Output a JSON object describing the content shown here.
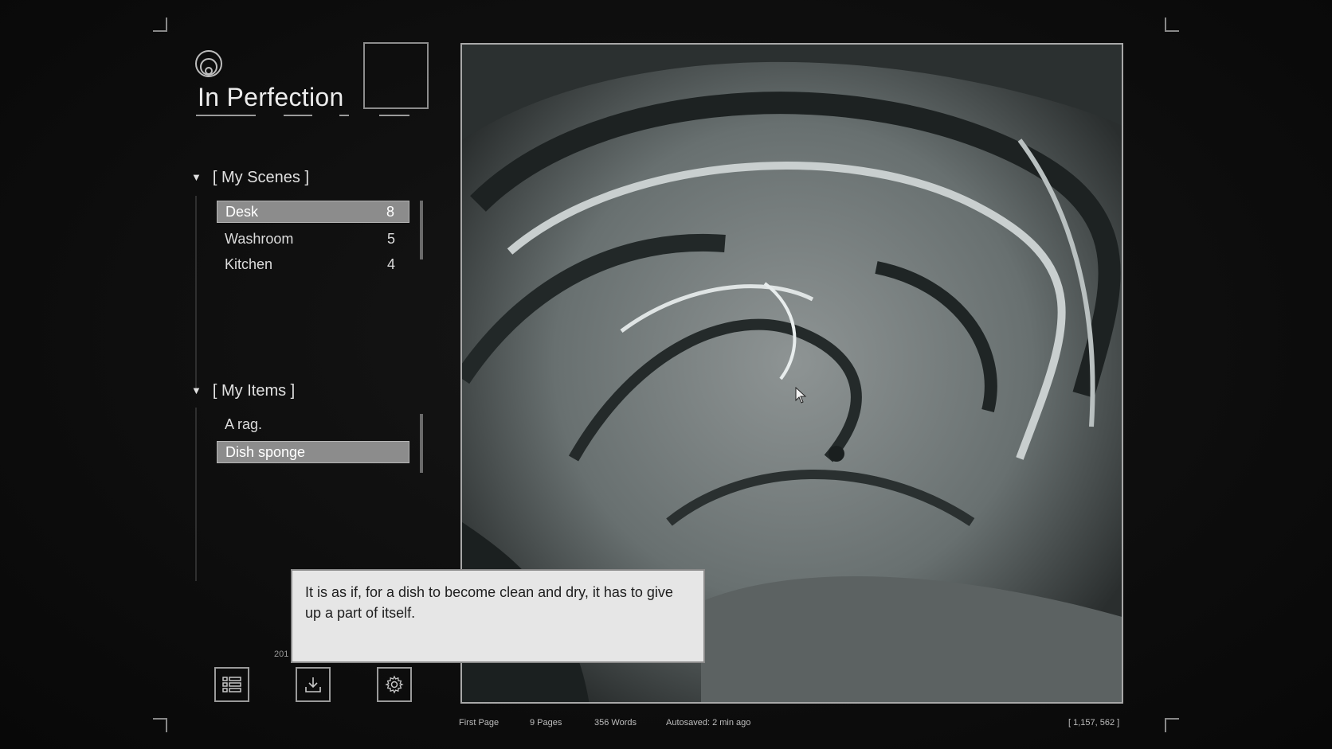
{
  "app": {
    "title": "In Perfection"
  },
  "sidebar": {
    "scenes": {
      "header": "My Scenes",
      "items": [
        {
          "label": "Desk",
          "count": "8",
          "selected": true
        },
        {
          "label": "Washroom",
          "count": "5",
          "selected": false
        },
        {
          "label": "Kitchen",
          "count": "4",
          "selected": false
        }
      ]
    },
    "items_section": {
      "header": "My Items",
      "items": [
        {
          "label": "A rag.",
          "selected": false
        },
        {
          "label": "Dish sponge",
          "selected": true
        }
      ]
    }
  },
  "tooltip": {
    "text": "It is as if, for a dish to become clean and dry, it has to give up a part of itself."
  },
  "partial_label": "201",
  "toolbar": {
    "icons": [
      "list-icon",
      "download-icon",
      "gear-icon"
    ]
  },
  "statusbar": {
    "first_page": "First Page",
    "pages": "9 Pages",
    "words": "356 Words",
    "autosaved": "Autosaved: 2 min ago",
    "coords": "[ 1,157, 562 ]"
  },
  "colors": {
    "background": "#0c0c0c",
    "selection": "#8c8c8c",
    "tooltip_bg": "#e6e6e6",
    "frame": "#a8a8a8"
  }
}
